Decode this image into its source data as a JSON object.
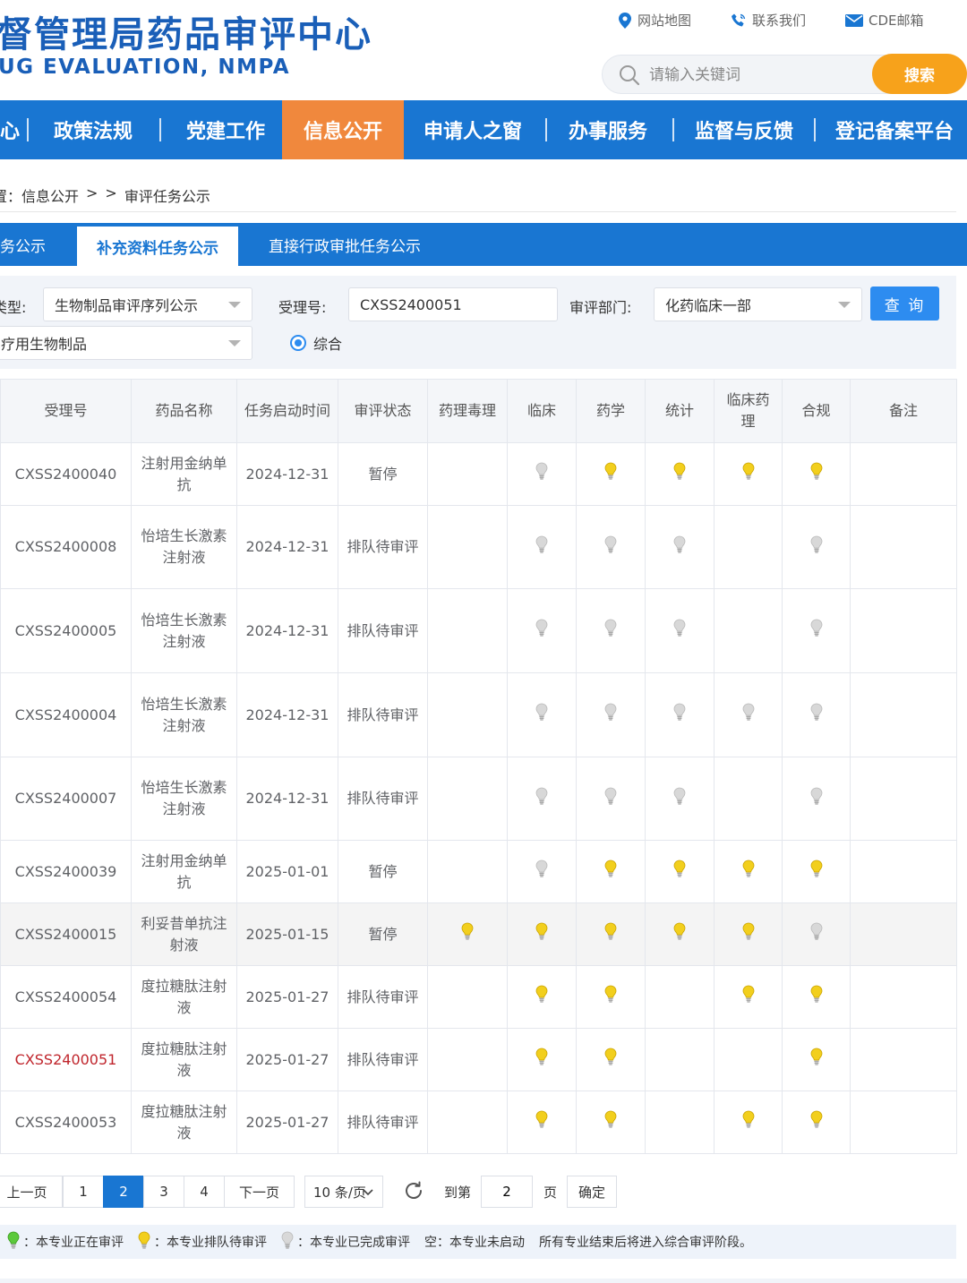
{
  "header": {
    "title_cn": "督管理局药品审评中心",
    "title_en": "UG EVALUATION, NMPA",
    "links": [
      {
        "label": "网站地图",
        "icon": "map-pin-icon"
      },
      {
        "label": "联系我们",
        "icon": "phone-icon"
      },
      {
        "label": "CDE邮箱",
        "icon": "mail-icon"
      }
    ],
    "search_placeholder": "请输入关键词",
    "search_button": "搜索"
  },
  "nav": {
    "items": [
      "心",
      "政策法规",
      "党建工作",
      "信息公开",
      "申请人之窗",
      "办事服务",
      "监督与反馈",
      "登记备案平台"
    ],
    "active_index": 3
  },
  "breadcrumb": {
    "items": [
      "置：信息公开",
      ">",
      ">",
      "审评任务公示"
    ]
  },
  "tabs": {
    "items": [
      "务公示",
      "补充资料任务公示",
      "直接行政审批任务公示"
    ],
    "active_index": 1
  },
  "filter": {
    "type_label": "类型:",
    "type_value": "生物制品审评序列公示",
    "accept_label": "受理号:",
    "accept_value": "CXSS2400051",
    "dept_label": "审评部门:",
    "dept_value": "化药临床一部",
    "query_button": "查 询",
    "subtype_value": "疗用生物制品",
    "radio_label": "综合"
  },
  "table": {
    "headers": [
      "受理号",
      "药品名称",
      "任务启动时间",
      "审评状态",
      "药理毒理",
      "临床",
      "药学",
      "统计",
      "临床药理",
      "合规",
      "备注"
    ],
    "rows": [
      {
        "id": "CXSS2400040",
        "name": "注射用金纳单抗",
        "date": "2024-12-31",
        "status": "暂停",
        "bulbs": [
          "",
          "grey",
          "yellow",
          "yellow",
          "yellow",
          "yellow"
        ],
        "note": "",
        "highlight": false,
        "red": false
      },
      {
        "id": "CXSS2400008",
        "name": "怡培生长激素注射液",
        "date": "2024-12-31",
        "status": "排队待审评",
        "bulbs": [
          "",
          "grey",
          "grey",
          "grey",
          "",
          "grey"
        ],
        "note": "",
        "highlight": false,
        "red": false
      },
      {
        "id": "CXSS2400005",
        "name": "怡培生长激素注射液",
        "date": "2024-12-31",
        "status": "排队待审评",
        "bulbs": [
          "",
          "grey",
          "grey",
          "grey",
          "",
          "grey"
        ],
        "note": "",
        "highlight": false,
        "red": false
      },
      {
        "id": "CXSS2400004",
        "name": "怡培生长激素注射液",
        "date": "2024-12-31",
        "status": "排队待审评",
        "bulbs": [
          "",
          "grey",
          "grey",
          "grey",
          "grey",
          "grey"
        ],
        "note": "",
        "highlight": false,
        "red": false
      },
      {
        "id": "CXSS2400007",
        "name": "怡培生长激素注射液",
        "date": "2024-12-31",
        "status": "排队待审评",
        "bulbs": [
          "",
          "grey",
          "grey",
          "grey",
          "",
          "grey"
        ],
        "note": "",
        "highlight": false,
        "red": false
      },
      {
        "id": "CXSS2400039",
        "name": "注射用金纳单抗",
        "date": "2025-01-01",
        "status": "暂停",
        "bulbs": [
          "",
          "grey",
          "yellow",
          "yellow",
          "yellow",
          "yellow"
        ],
        "note": "",
        "highlight": false,
        "red": false
      },
      {
        "id": "CXSS2400015",
        "name": "利妥昔单抗注射液",
        "date": "2025-01-15",
        "status": "暂停",
        "bulbs": [
          "yellow",
          "yellow",
          "yellow",
          "yellow",
          "yellow",
          "grey"
        ],
        "note": "",
        "highlight": true,
        "red": false
      },
      {
        "id": "CXSS2400054",
        "name": "度拉糖肽注射液",
        "date": "2025-01-27",
        "status": "排队待审评",
        "bulbs": [
          "",
          "yellow",
          "yellow",
          "",
          "yellow",
          "yellow"
        ],
        "note": "",
        "highlight": false,
        "red": false
      },
      {
        "id": "CXSS2400051",
        "name": "度拉糖肽注射液",
        "date": "2025-01-27",
        "status": "排队待审评",
        "bulbs": [
          "",
          "yellow",
          "yellow",
          "",
          "",
          "yellow"
        ],
        "note": "",
        "highlight": false,
        "red": true
      },
      {
        "id": "CXSS2400053",
        "name": "度拉糖肽注射液",
        "date": "2025-01-27",
        "status": "排队待审评",
        "bulbs": [
          "",
          "yellow",
          "yellow",
          "",
          "yellow",
          "yellow"
        ],
        "note": "",
        "highlight": false,
        "red": false
      }
    ]
  },
  "pager": {
    "prev": "上一页",
    "pages": [
      "1",
      "2",
      "3",
      "4"
    ],
    "current": "2",
    "next": "下一页",
    "page_size": "10 条/页",
    "goto_label": "到第",
    "goto_value": "2",
    "goto_unit": "页",
    "confirm": "确定"
  },
  "legend": {
    "items": [
      {
        "bulb": "green",
        "text": "：本专业正在审评"
      },
      {
        "bulb": "yellow",
        "text": "：本专业排队待审评"
      },
      {
        "bulb": "grey",
        "text": "：本专业已完成审评"
      }
    ],
    "empty_text": "空：本专业未启动",
    "note": "所有专业结束后将进入综合审评阶段。"
  },
  "colors": {
    "primary_blue": "#1976d2",
    "nav_active_orange": "#f0883d",
    "search_orange": "#f7a21b",
    "bulb_yellow": "#f2cf1d",
    "bulb_grey": "#d8d8d8",
    "bulb_green": "#5cc93b",
    "highlight_red": "#c0262d"
  }
}
